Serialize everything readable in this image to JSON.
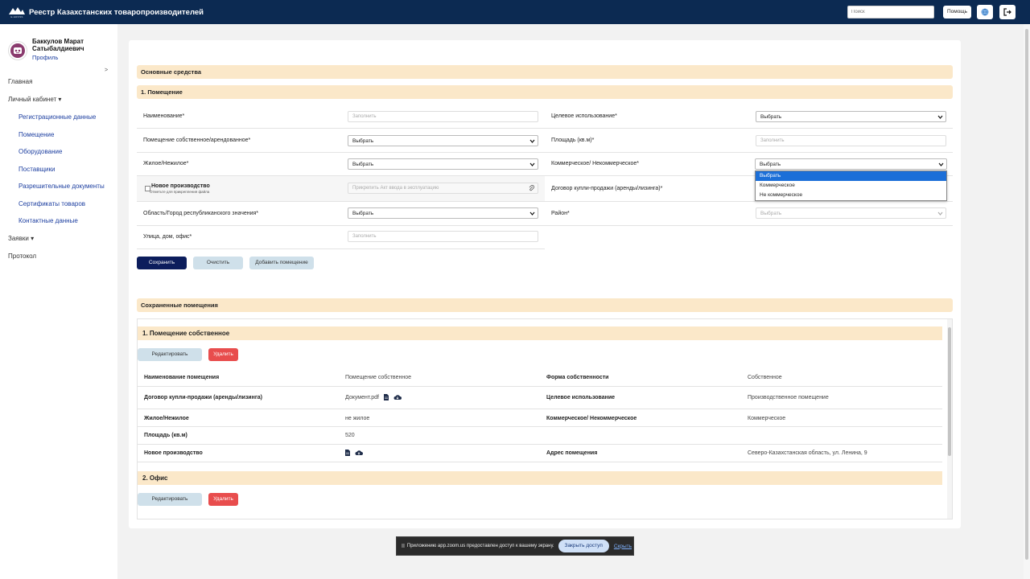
{
  "header": {
    "logo_sub": "E-GROSS",
    "title": "Реестр Казахстанских товаропроизводителей",
    "search_placeholder": "Поиск",
    "help_label": "Помощь",
    "globe_icon": "globe-icon",
    "exit_icon": "logout-icon"
  },
  "user": {
    "name_line1": "Баккулов Марат",
    "name_line2": "Сатыбалдиевич",
    "profile_label": "Профиль",
    "arrow": ">"
  },
  "nav": {
    "home": "Главная",
    "cabinet": "Личный кабинет",
    "cabinet_items": [
      "Регистрационные данные",
      "Помещение",
      "Оборудование",
      "Поставщики",
      "Разрешительные документы",
      "Сертификаты товаров",
      "Контактные данные"
    ],
    "requests": "Заявки",
    "protocol": "Протокол"
  },
  "form": {
    "section_title": "Основные средства",
    "subsection_title": "1. Помещение",
    "name_label": "Наименование*",
    "name_placeholder": "Заполнить",
    "purpose_label": "Целевое использование*",
    "purpose_value": "Выбрать",
    "ownership_label": "Помещение собственное/арендованное*",
    "ownership_value": "Выбрать",
    "area_label": "Площадь (кв.м)*",
    "area_placeholder": "Заполнить",
    "residential_label": "Жилое/Нежилое*",
    "residential_value": "Выбрать",
    "commercial_label": "Коммерческое/ Некоммерческое*",
    "commercial_value": "Выбрать",
    "commercial_options": [
      "Выбрать",
      "Коммерческое",
      "Не коммерческое"
    ],
    "new_prod_label": "Новое производство",
    "new_prod_hint": "Отметьте для прикрепления файла",
    "attach_placeholder": "Прикрепить Акт ввода в эксплуатацию",
    "contract_label": "Договор купли-продажи (аренды/лизинга)*",
    "region_label": "Область/Город республиканского значения*",
    "region_value": "Выбрать",
    "district_label": "Район*",
    "district_value": "Выбрать",
    "street_label": "Улица, дом, офис*",
    "street_placeholder": "Заполнить",
    "save_btn": "Сохранить",
    "clear_btn": "Очистить",
    "add_btn": "Добавить помещение"
  },
  "saved": {
    "title": "Сохраненные помещения",
    "item1": {
      "title": "1. Помещение собственное",
      "edit_btn": "Редактировать",
      "delete_btn": "Удалить",
      "rows": [
        {
          "l1": "Наименование помещения",
          "v1": "Помещение собственное",
          "l2": "Форма собственности",
          "v2": "Собственное"
        },
        {
          "l1": "Договор купли-продажи (аренды/лизинга)",
          "v1": "Документ.pdf",
          "l2": "Целевое использование",
          "v2": "Производственное помещение"
        },
        {
          "l1": "Жилое/Нежилое",
          "v1": "не жилое",
          "l2": "Коммерческое/ Некоммерческое",
          "v2": "Коммерческое"
        },
        {
          "l1": "Площадь (кв.м)",
          "v1": "520",
          "l2": "",
          "v2": ""
        },
        {
          "l1": "Новое производство",
          "v1": "",
          "l2": "Адрес помещения",
          "v2": "Северо-Казахстанская область, ул. Ленина, 9"
        }
      ]
    },
    "item2": {
      "title": "2. Офис",
      "edit_btn": "Редактировать",
      "delete_btn": "Удалить"
    }
  },
  "zoom": {
    "pause": "II",
    "text": "Приложению app.zoom.us предоставлен доступ к вашему экрану.",
    "close_btn": "Закрыть доступ",
    "hide_link": "Скрыть"
  }
}
